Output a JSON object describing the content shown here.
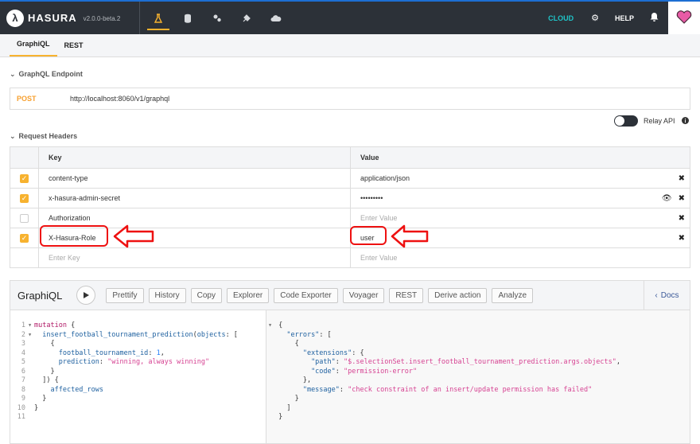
{
  "app": {
    "brand": "HASURA",
    "version": "v2.0.0-beta.2",
    "nav_icons": [
      "graphiql-icon",
      "data-icon",
      "actions-icon",
      "remote-schemas-icon",
      "events-icon"
    ],
    "right": {
      "cloud": "CLOUD",
      "help": "HELP"
    }
  },
  "tabs": [
    "GraphiQL",
    "REST"
  ],
  "endpoint": {
    "title": "GraphQL Endpoint",
    "method": "POST",
    "url": "http://localhost:8060/v1/graphql"
  },
  "relay": {
    "label": "Relay API"
  },
  "headers": {
    "title": "Request Headers",
    "columns": [
      "Key",
      "Value"
    ],
    "rows": [
      {
        "checked": true,
        "key": "content-type",
        "value": "application/json",
        "value_placeholder": false
      },
      {
        "checked": true,
        "key": "x-hasura-admin-secret",
        "value": "•••••••••",
        "value_placeholder": false
      },
      {
        "checked": false,
        "key": "Authorization",
        "value": "Enter Value",
        "value_placeholder": true
      },
      {
        "checked": true,
        "key": "X-Hasura-Role",
        "value": "user",
        "value_placeholder": false
      }
    ],
    "new_row": {
      "key_placeholder": "Enter Key",
      "value_placeholder": "Enter Value"
    }
  },
  "graphiql": {
    "title": "GraphiQL",
    "buttons": [
      "Prettify",
      "History",
      "Copy",
      "Explorer",
      "Code Exporter",
      "Voyager",
      "REST",
      "Derive action",
      "Analyze"
    ],
    "docs": "Docs",
    "query_lines": [
      "mutation {",
      "  insert_football_tournament_prediction(objects: [",
      "    {",
      "      football_tournament_id: 1,",
      "      prediction: \"winning, always winning\"",
      "    }",
      "  ]) {",
      "    affected_rows",
      "  }",
      "}",
      ""
    ],
    "result_lines": [
      "{",
      "  \"errors\": [",
      "    {",
      "      \"extensions\": {",
      "        \"path\": \"$.selectionSet.insert_football_tournament_prediction.args.objects\",",
      "        \"code\": \"permission-error\"",
      "      },",
      "      \"message\": \"check constraint of an insert/update permission has failed\"",
      "    }",
      "  ]",
      "}"
    ]
  },
  "colors": {
    "accent": "#f7b22f",
    "nav_bg": "#2c3138",
    "annotation": "#e11111"
  }
}
